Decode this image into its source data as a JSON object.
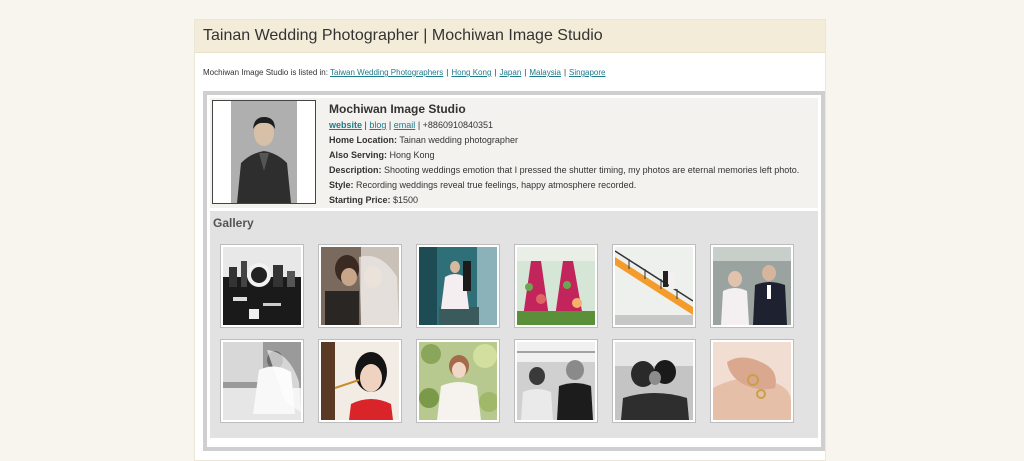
{
  "header": {
    "title": "Tainan Wedding Photographer | Mochiwan Image Studio"
  },
  "listing": {
    "prefix": "Mochiwan Image Studio is listed in:",
    "links": [
      "Taiwan Wedding Photographers",
      "Hong Kong",
      "Japan",
      "Malaysia",
      "Singapore"
    ],
    "separator": "|"
  },
  "profile": {
    "name": "Mochiwan Image Studio",
    "links": {
      "website": "website",
      "blog": "blog",
      "email": "email"
    },
    "phone": "+8860910840351",
    "home_location_label": "Home Location:",
    "home_location": "Tainan wedding photographer",
    "also_serving_label": "Also Serving:",
    "also_serving": "Hong Kong",
    "description_label": "Description:",
    "description": "Shooting weddings emotion that I pressed the shutter timing, my photos are eternal memories left photo.",
    "style_label": "Style:",
    "style": "Recording weddings reveal true feelings, happy atmosphere recorded.",
    "price_label": "Starting Price:",
    "price": "$1500"
  },
  "gallery": {
    "title": "Gallery",
    "thumbs": [
      {
        "name": "bw-city-couple-photo"
      },
      {
        "name": "bride-veil-photo"
      },
      {
        "name": "bride-stairs-photo"
      },
      {
        "name": "floral-dresses-photo"
      },
      {
        "name": "couple-staircase-photo"
      },
      {
        "name": "couple-portrait-photo"
      },
      {
        "name": "bride-bedroom-photo"
      },
      {
        "name": "bride-makeup-photo"
      },
      {
        "name": "bride-garden-photo"
      },
      {
        "name": "bw-guests-photo"
      },
      {
        "name": "bw-couple-kiss-photo"
      },
      {
        "name": "wedding-rings-photo"
      }
    ]
  },
  "colors": {
    "link": "#1f7a8c",
    "title_bar": "#f3ecd9",
    "gallery_bg": "#e2e2e2"
  }
}
